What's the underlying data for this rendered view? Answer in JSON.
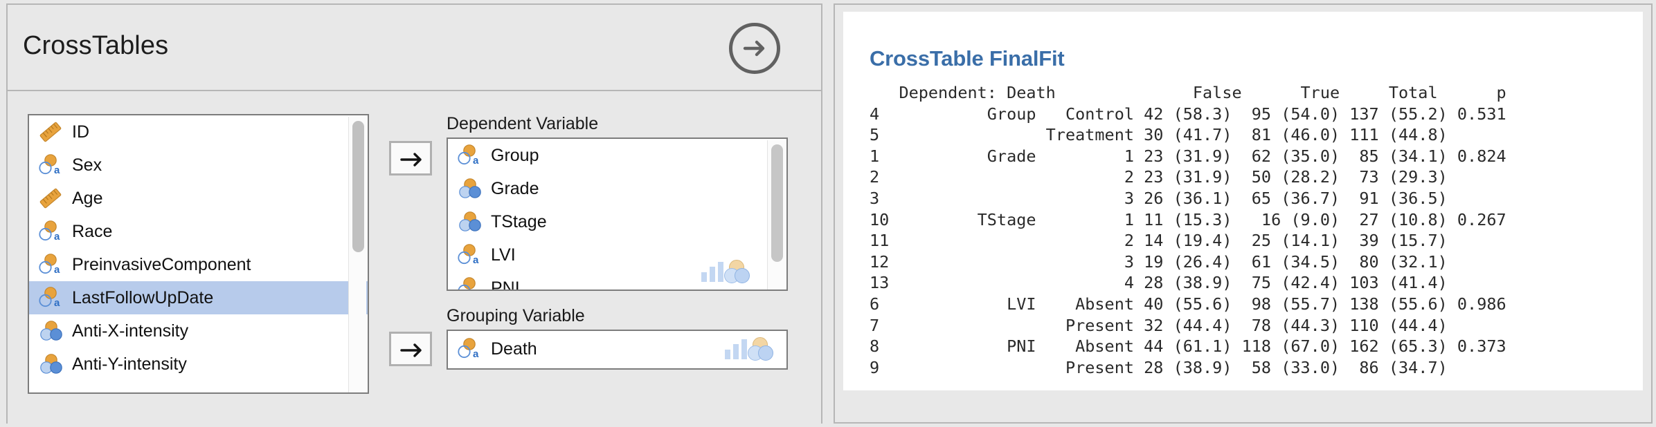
{
  "analysis": {
    "title": "CrossTables",
    "run_button_icon": "arrow-right-circle-icon",
    "source_list": {
      "items": [
        {
          "label": "ID",
          "icon": "ruler-icon",
          "selected": false
        },
        {
          "label": "Sex",
          "icon": "nominal-text-icon",
          "selected": false
        },
        {
          "label": "Age",
          "icon": "ruler-icon",
          "selected": false
        },
        {
          "label": "Race",
          "icon": "nominal-text-icon",
          "selected": false
        },
        {
          "label": "PreinvasiveComponent",
          "icon": "nominal-text-icon",
          "selected": false
        },
        {
          "label": "LastFollowUpDate",
          "icon": "nominal-text-icon",
          "selected": true
        },
        {
          "label": "Anti-X-intensity",
          "icon": "ordinal-icon",
          "selected": false
        },
        {
          "label": "Anti-Y-intensity",
          "icon": "ordinal-icon",
          "selected": false
        }
      ]
    },
    "dependent": {
      "label": "Dependent Variable",
      "transfer_button_icon": "arrow-right-icon",
      "items": [
        {
          "label": "Group",
          "icon": "nominal-text-icon"
        },
        {
          "label": "Grade",
          "icon": "ordinal-icon"
        },
        {
          "label": "TStage",
          "icon": "ordinal-icon"
        },
        {
          "label": "LVI",
          "icon": "nominal-text-icon"
        },
        {
          "label": "PNI",
          "icon": "nominal-text-icon"
        }
      ]
    },
    "grouping": {
      "label": "Grouping Variable",
      "transfer_button_icon": "arrow-right-icon",
      "items": [
        {
          "label": "Death",
          "icon": "nominal-text-icon"
        }
      ]
    }
  },
  "results": {
    "title": "CrossTable FinalFit",
    "columns": [
      "",
      "Dependent: Death",
      "",
      "False",
      "True",
      "Total",
      "p"
    ],
    "header_line": "   Dependent: Death              False      True     Total      p",
    "rows": [
      {
        "index": "4",
        "variable": "Group",
        "level": "Control",
        "false": "42 (58.3)",
        "true": "95 (54.0)",
        "total": "137 (55.2)",
        "p": "0.531"
      },
      {
        "index": "5",
        "variable": "",
        "level": "Treatment",
        "false": "30 (41.7)",
        "true": "81 (46.0)",
        "total": "111 (44.8)",
        "p": ""
      },
      {
        "index": "1",
        "variable": "Grade",
        "level": "1",
        "false": "23 (31.9)",
        "true": "62 (35.0)",
        "total": "85 (34.1)",
        "p": "0.824"
      },
      {
        "index": "2",
        "variable": "",
        "level": "2",
        "false": "23 (31.9)",
        "true": "50 (28.2)",
        "total": "73 (29.3)",
        "p": ""
      },
      {
        "index": "3",
        "variable": "",
        "level": "3",
        "false": "26 (36.1)",
        "true": "65 (36.7)",
        "total": "91 (36.5)",
        "p": ""
      },
      {
        "index": "10",
        "variable": "TStage",
        "level": "1",
        "false": "11 (15.3)",
        "true": "16 (9.0)",
        "total": "27 (10.8)",
        "p": "0.267"
      },
      {
        "index": "11",
        "variable": "",
        "level": "2",
        "false": "14 (19.4)",
        "true": "25 (14.1)",
        "total": "39 (15.7)",
        "p": ""
      },
      {
        "index": "12",
        "variable": "",
        "level": "3",
        "false": "19 (26.4)",
        "true": "61 (34.5)",
        "total": "80 (32.1)",
        "p": ""
      },
      {
        "index": "13",
        "variable": "",
        "level": "4",
        "false": "28 (38.9)",
        "true": "75 (42.4)",
        "total": "103 (41.4)",
        "p": ""
      },
      {
        "index": "6",
        "variable": "LVI",
        "level": "Absent",
        "false": "40 (55.6)",
        "true": "98 (55.7)",
        "total": "138 (55.6)",
        "p": "0.986"
      },
      {
        "index": "7",
        "variable": "",
        "level": "Present",
        "false": "32 (44.4)",
        "true": "78 (44.3)",
        "total": "110 (44.4)",
        "p": ""
      },
      {
        "index": "8",
        "variable": "PNI",
        "level": "Absent",
        "false": "44 (61.1)",
        "true": "118 (67.0)",
        "total": "162 (65.3)",
        "p": "0.373"
      },
      {
        "index": "9",
        "variable": "",
        "level": "Present",
        "false": "28 (38.9)",
        "true": "58 (33.0)",
        "total": "86 (34.7)",
        "p": ""
      }
    ],
    "text": "   Dependent: Death              False      True     Total      p\n4           Group   Control 42 (58.3)  95 (54.0) 137 (55.2) 0.531\n5                 Treatment 30 (41.7)  81 (46.0) 111 (44.8)\n1           Grade         1 23 (31.9)  62 (35.0)  85 (34.1) 0.824\n2                         2 23 (31.9)  50 (28.2)  73 (29.3)\n3                         3 26 (36.1)  65 (36.7)  91 (36.5)\n10         TStage         1 11 (15.3)   16 (9.0)  27 (10.8) 0.267\n11                        2 14 (19.4)  25 (14.1)  39 (15.7)\n12                        3 19 (26.4)  61 (34.5)  80 (32.1)\n13                        4 28 (38.9)  75 (42.4) 103 (41.4)\n6             LVI    Absent 40 (55.6)  98 (55.7) 138 (55.6) 0.986\n7                   Present 32 (44.4)  78 (44.3) 110 (44.4)\n8             PNI    Absent 44 (61.1) 118 (67.0) 162 (65.3) 0.373\n9                   Present 28 (38.9)  58 (33.0)  86 (34.7)"
  },
  "colors": {
    "accent": "#3a6ea8",
    "selection": "#b7cbeb",
    "panel_bg": "#e8e8e8",
    "icon_orange": "#e8a33d",
    "icon_blue": "#5b8fd6",
    "icon_blue_light": "#bdd3f0"
  }
}
